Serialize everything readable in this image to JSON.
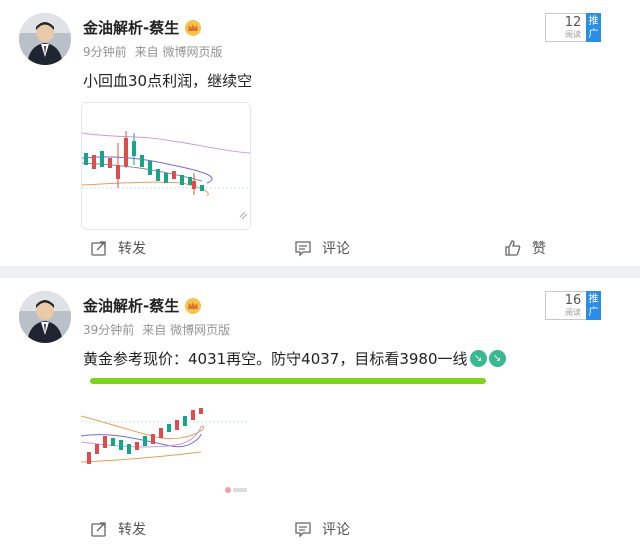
{
  "posts": [
    {
      "author": "金油解析-蔡生",
      "time": "9分钟前",
      "source": "来自 微博网页版",
      "read_count": "12",
      "read_label": "阅读",
      "promo_label": "推广",
      "text": "小回血30点利润，继续空",
      "actions": {
        "repost": "转发",
        "comment": "评论",
        "like": "赞"
      }
    },
    {
      "author": "金油解析-蔡生",
      "time": "39分钟前",
      "source": "来自 微博网页版",
      "read_count": "16",
      "read_label": "阅读",
      "promo_label": "推广",
      "text": "黄金参考现价：4031再空。防守4037，目标看3980一线",
      "actions": {
        "repost": "转发",
        "comment": "评论"
      }
    }
  ],
  "colors": {
    "accent_blue": "#2a8de8",
    "meta_gray": "#939393",
    "highlight_green": "#7ed321",
    "candle_up": "#e04b4b",
    "candle_down": "#17a589"
  },
  "icons": [
    "crown-icon",
    "repost-icon",
    "comment-icon",
    "like-icon",
    "trend-down-emoji"
  ]
}
